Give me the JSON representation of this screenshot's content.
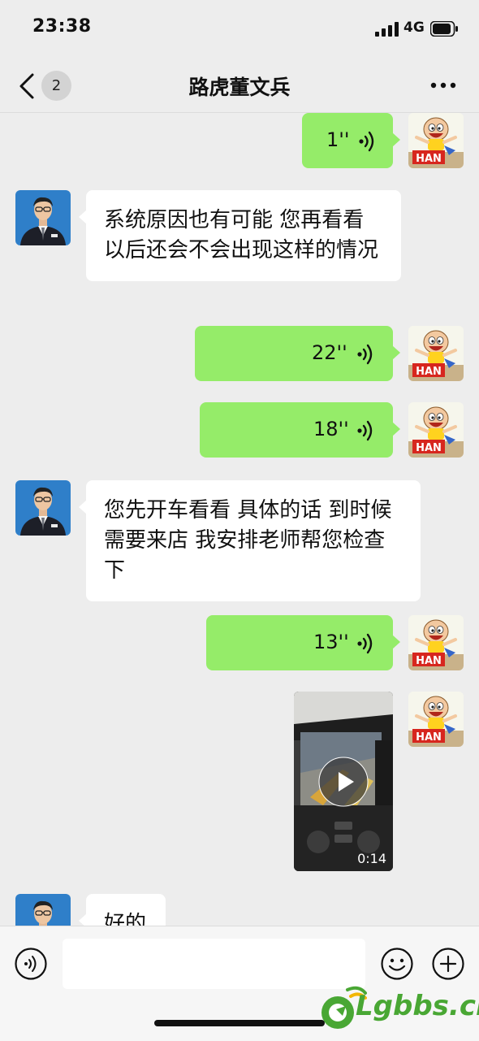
{
  "status_bar": {
    "time": "23:38",
    "network": "4G"
  },
  "header": {
    "back_count": "2",
    "title": "路虎董文兵"
  },
  "messages": [
    {
      "side": "out",
      "type": "voice",
      "duration": "1''"
    },
    {
      "side": "in",
      "type": "text",
      "text": "系统原因也有可能  您再看看  以后还会不会出现这样的情况"
    },
    {
      "side": "out",
      "type": "voice",
      "duration": "22''"
    },
    {
      "side": "out",
      "type": "voice",
      "duration": "18''"
    },
    {
      "side": "in",
      "type": "text",
      "text": "您先开车看看    具体的话 到时候需要来店 我安排老师帮您检查下"
    },
    {
      "side": "out",
      "type": "voice",
      "duration": "13''"
    },
    {
      "side": "out",
      "type": "video",
      "duration": "0:14"
    },
    {
      "side": "in",
      "type": "text",
      "text": "好的"
    }
  ],
  "avatars": {
    "me_text": "HAN"
  },
  "input_bar": {
    "placeholder": ""
  },
  "watermark": {
    "text": "Lgbbs.cn"
  },
  "colors": {
    "background": "#ededed",
    "outgoing_bubble": "#95ec69",
    "incoming_bubble": "#ffffff",
    "watermark": "#49a734"
  },
  "icons": [
    "back-chevron-icon",
    "more-icon",
    "voice-wave-icon",
    "play-icon",
    "voice-input-icon",
    "emoji-icon",
    "add-icon"
  ]
}
